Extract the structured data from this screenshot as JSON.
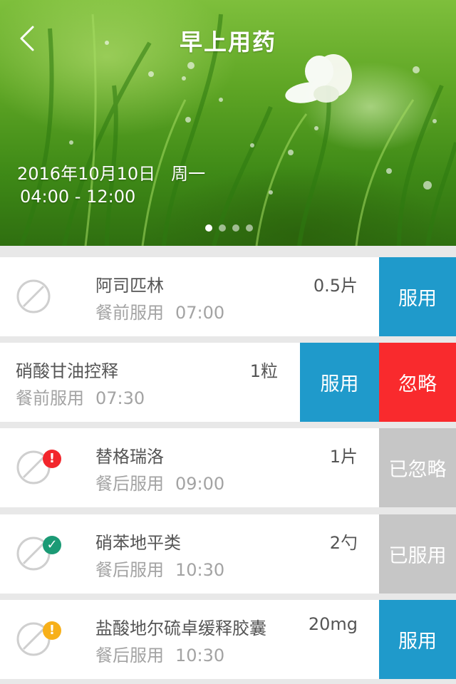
{
  "header": {
    "title": "早上用药",
    "date": "2016年10月10日",
    "weekday": "周一",
    "time_range": "04:00 - 12:00",
    "carousel_dots": 4,
    "carousel_active": 1
  },
  "colors": {
    "blue": "#1f9acb",
    "red": "#f92a2d",
    "gray": "#c6c6c6",
    "warning_red": "#f2262c",
    "taken_green": "#1b9a75",
    "pending_yellow": "#f7b01a"
  },
  "meds": [
    {
      "name": "阿司匹林",
      "dose": "0.5片",
      "instruction": "餐前服用",
      "time": "07:00",
      "action": "服用",
      "icon": "pill-icon"
    },
    {
      "name": "硝酸甘油控释",
      "dose": "1粒",
      "instruction": "餐前服用",
      "time": "07:30",
      "action": "服用",
      "action2": "忽略"
    },
    {
      "name": "替格瑞洛",
      "dose": "1片",
      "instruction": "餐后服用",
      "time": "09:00",
      "action": "已忽略",
      "badge": "!",
      "badge_icon": "alert-icon"
    },
    {
      "name": "硝苯地平类",
      "dose": "2勺",
      "instruction": "餐后服用",
      "time": "10:30",
      "action": "已服用",
      "badge": "✓",
      "badge_icon": "check-icon"
    },
    {
      "name": "盐酸地尔硫卓缓释胶囊",
      "dose": "20mg",
      "instruction": "餐后服用",
      "time": "10:30",
      "action": "服用",
      "badge": "!",
      "badge_icon": "warning-icon"
    }
  ]
}
